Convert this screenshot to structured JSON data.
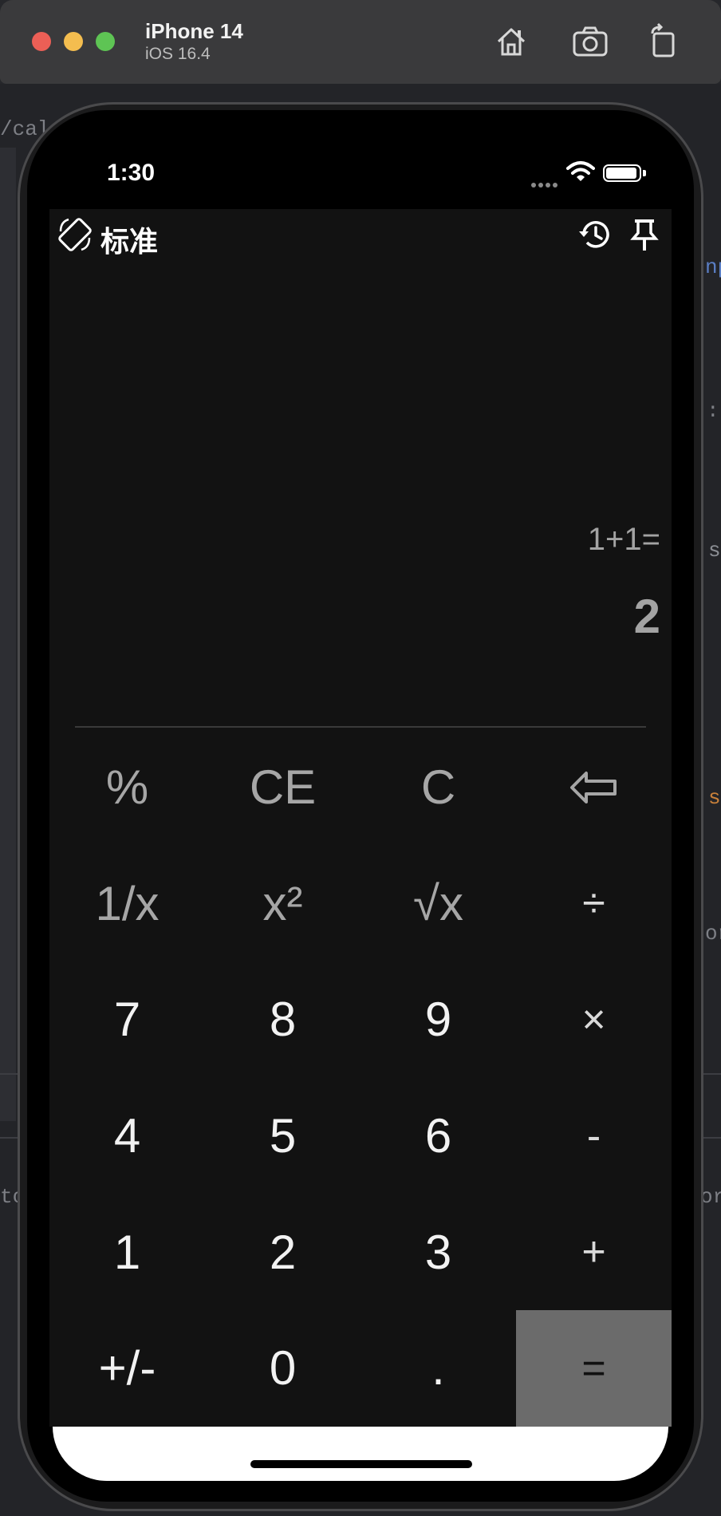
{
  "simulator": {
    "device_name": "iPhone 14",
    "os_version": "iOS 16.4",
    "toolbar": [
      "home-icon",
      "screenshot-icon",
      "rotate-icon"
    ]
  },
  "background_editor": {
    "visible_fragments": [
      "/calc",
      "np",
      ":",
      "s",
      "s",
      "or",
      "to",
      "or"
    ]
  },
  "status_bar": {
    "time": "1:30",
    "icons": [
      "signal-dots-icon",
      "wifi-icon",
      "battery-icon"
    ]
  },
  "app": {
    "mode_title": "标准",
    "header_icons": [
      "rotate-screen-icon",
      "history-icon",
      "pin-icon"
    ]
  },
  "display": {
    "expression": "1+1=",
    "result": "2"
  },
  "keypad": {
    "rows": [
      [
        {
          "label": "%",
          "name": "percent-key",
          "style": "dim"
        },
        {
          "label": "CE",
          "name": "clear-entry-key",
          "style": "dim"
        },
        {
          "label": "C",
          "name": "clear-key",
          "style": "dim"
        },
        {
          "label": "",
          "name": "backspace-key",
          "style": "dim",
          "icon": "backspace-icon"
        }
      ],
      [
        {
          "label": "1/x",
          "name": "reciprocal-key",
          "style": "dim"
        },
        {
          "label": "x²",
          "name": "square-key",
          "style": "dim"
        },
        {
          "label": "√x",
          "name": "sqrt-key",
          "style": "dim"
        },
        {
          "label": "÷",
          "name": "divide-key",
          "style": "op"
        }
      ],
      [
        {
          "label": "7",
          "name": "digit-7-key",
          "style": "num"
        },
        {
          "label": "8",
          "name": "digit-8-key",
          "style": "num"
        },
        {
          "label": "9",
          "name": "digit-9-key",
          "style": "num"
        },
        {
          "label": "×",
          "name": "multiply-key",
          "style": "op"
        }
      ],
      [
        {
          "label": "4",
          "name": "digit-4-key",
          "style": "num"
        },
        {
          "label": "5",
          "name": "digit-5-key",
          "style": "num"
        },
        {
          "label": "6",
          "name": "digit-6-key",
          "style": "num"
        },
        {
          "label": "-",
          "name": "subtract-key",
          "style": "op"
        }
      ],
      [
        {
          "label": "1",
          "name": "digit-1-key",
          "style": "num"
        },
        {
          "label": "2",
          "name": "digit-2-key",
          "style": "num"
        },
        {
          "label": "3",
          "name": "digit-3-key",
          "style": "num"
        },
        {
          "label": "+",
          "name": "add-key",
          "style": "op"
        }
      ],
      [
        {
          "label": "+/-",
          "name": "negate-key",
          "style": "num"
        },
        {
          "label": "0",
          "name": "digit-0-key",
          "style": "num"
        },
        {
          "label": ".",
          "name": "decimal-key",
          "style": "num"
        },
        {
          "label": "=",
          "name": "equals-key",
          "style": "equals"
        }
      ]
    ]
  },
  "colors": {
    "screen_bg": "#121212",
    "equals_bg": "#6b6b6b",
    "dim_text": "#a6a6a6",
    "digit_text": "#f2f2f2"
  }
}
